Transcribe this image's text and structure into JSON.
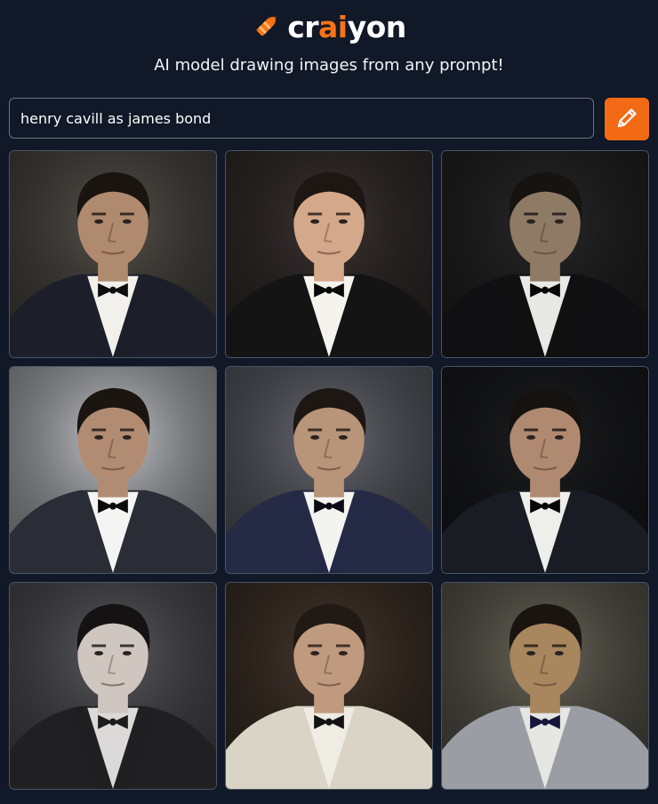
{
  "header": {
    "logo_prefix": "cr",
    "logo_accent": "ai",
    "logo_suffix": "yon",
    "tagline": "AI model drawing images from any prompt!"
  },
  "prompt": {
    "value": "henry cavill as james bond",
    "button_icon": "pencil-icon"
  },
  "colors": {
    "background": "#111827",
    "accent": "#f26a16",
    "input_border": "#6b7280"
  },
  "images": [
    {
      "bg": "#5a5550",
      "suit": "#1c1f2a",
      "skin": "#b08a6e",
      "hair": "#1a1410",
      "shirt": "#f2f0ea",
      "tie": "#0d0d10"
    },
    {
      "bg": "#3d3634",
      "suit": "#141414",
      "skin": "#d4a88a",
      "hair": "#1d1612",
      "shirt": "#f5f3ee",
      "tie": "#080808"
    },
    {
      "bg": "#2a2a2c",
      "suit": "#101012",
      "skin": "#8f7a66",
      "hair": "#161311",
      "shirt": "#e8e8e4",
      "tie": "#070707"
    },
    {
      "bg": "#c9ccd0",
      "suit": "#2a2d36",
      "skin": "#b28c72",
      "hair": "#1a1511",
      "shirt": "#f4f4f2",
      "tie": "#0a0a0a"
    },
    {
      "bg": "#6d6f78",
      "suit": "#252a45",
      "skin": "#b89478",
      "hair": "#1c1713",
      "shirt": "#f3f3f0",
      "tie": "#0a0b14"
    },
    {
      "bg": "#1e1f22",
      "suit": "#1a1c24",
      "skin": "#b08a70",
      "hair": "#15120f",
      "shirt": "#eeeeea",
      "tie": "#060606"
    },
    {
      "bg": "#5e5d62",
      "suit": "#202022",
      "skin": "#cfc6c0",
      "hair": "#141212",
      "shirt": "#dcdad8",
      "tie": "#1c1c1e"
    },
    {
      "bg": "#4a3b30",
      "suit": "#d9d4c6",
      "skin": "#c09a7e",
      "hair": "#201914",
      "shirt": "#efece4",
      "tie": "#121212"
    },
    {
      "bg": "#6e6a5e",
      "suit": "#9a9ea4",
      "skin": "#a8865e",
      "hair": "#1a1411",
      "shirt": "#e6e6e2",
      "tie": "#16163a"
    }
  ]
}
